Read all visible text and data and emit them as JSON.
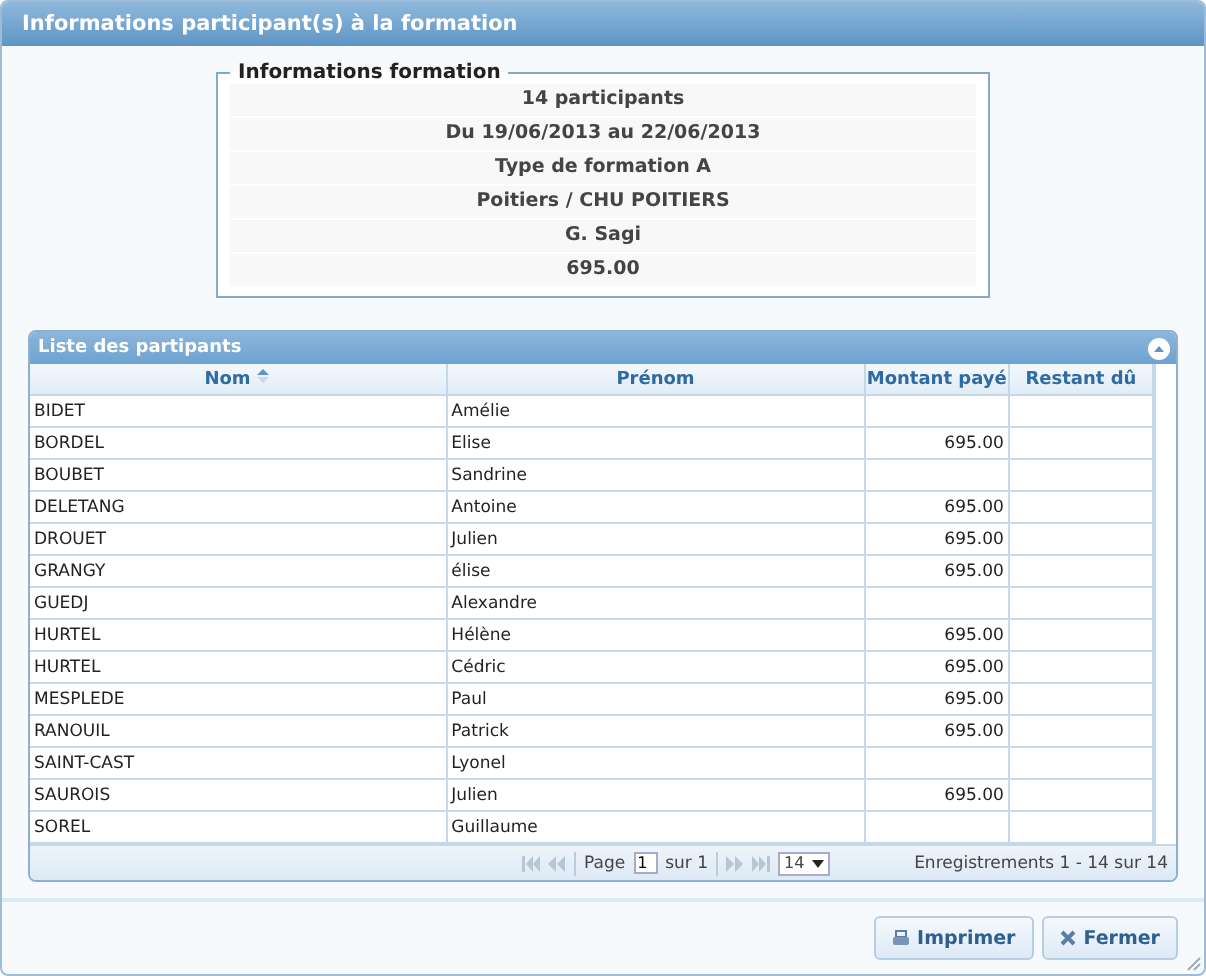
{
  "window": {
    "title": "Informations participant(s) à la formation"
  },
  "formation": {
    "legend": "Informations formation",
    "lines": [
      "14 participants",
      "Du 19/06/2013 au 22/06/2013",
      "Type de formation A",
      "Poitiers / CHU POITIERS",
      "G. Sagi",
      "695.00"
    ]
  },
  "grid": {
    "title": "Liste des partipants",
    "columns": [
      {
        "label": "Nom",
        "sorted": true
      },
      {
        "label": "Prénom",
        "sorted": false
      },
      {
        "label": "Montant payé",
        "sorted": false
      },
      {
        "label": "Restant dû",
        "sorted": false
      }
    ],
    "rows": [
      [
        "BIDET",
        "Amélie",
        "",
        ""
      ],
      [
        "BORDEL",
        "Elise",
        "695.00",
        ""
      ],
      [
        "BOUBET",
        "Sandrine",
        "",
        ""
      ],
      [
        "DELETANG",
        "Antoine",
        "695.00",
        ""
      ],
      [
        "DROUET",
        "Julien",
        "695.00",
        ""
      ],
      [
        "GRANGY",
        "élise",
        "695.00",
        ""
      ],
      [
        "GUEDJ",
        "Alexandre",
        "",
        ""
      ],
      [
        "HURTEL",
        "Hélène",
        "695.00",
        ""
      ],
      [
        "HURTEL",
        "Cédric",
        "695.00",
        ""
      ],
      [
        "MESPLEDE",
        "Paul",
        "695.00",
        ""
      ],
      [
        "RANOUIL",
        "Patrick",
        "695.00",
        ""
      ],
      [
        "SAINT-CAST",
        "Lyonel",
        "",
        ""
      ],
      [
        "SAUROIS",
        "Julien",
        "695.00",
        ""
      ],
      [
        "SOREL",
        "Guillaume",
        "",
        ""
      ]
    ],
    "pager": {
      "page_label": "Page",
      "page": "1",
      "of_label": "sur 1",
      "page_size": "14",
      "summary": "Enregistrements 1 - 14 sur 14"
    }
  },
  "buttons": [
    {
      "kind": "print",
      "label": "Imprimer"
    },
    {
      "kind": "close",
      "label": "Fermer"
    }
  ]
}
